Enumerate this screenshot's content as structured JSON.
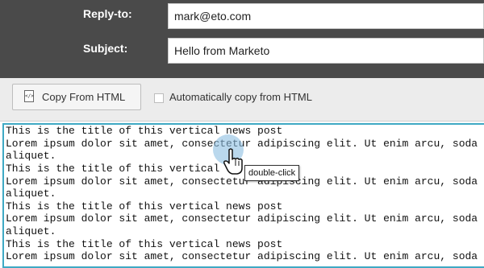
{
  "header": {
    "reply_to_label": "Reply-to:",
    "reply_to_value": "mark@eto.com",
    "subject_label": "Subject:",
    "subject_value": "Hello from Marketo"
  },
  "toolbar": {
    "copy_button_label": "Copy From HTML",
    "auto_copy_label": "Automatically copy from HTML",
    "auto_copy_checked": false
  },
  "editor": {
    "lines": [
      "This is the title of this vertical news post",
      "Lorem ipsum dolor sit amet, consectetur adipiscing elit. Ut enim arcu, soda",
      "aliquet.",
      "This is the title of this vertical",
      "Lorem ipsum dolor sit amet, consectetur adipiscing elit. Ut enim arcu, soda",
      "aliquet.",
      "This is the title of this vertical news post",
      "Lorem ipsum dolor sit amet, consectetur adipiscing elit. Ut enim arcu, soda",
      "aliquet.",
      "This is the title of this vertical news post",
      "Lorem ipsum dolor sit amet, consectetur adipiscing elit. Ut enim arcu, soda"
    ]
  },
  "annotation": {
    "tooltip_text": "double-click",
    "cursor_icon": "hand-pointer-icon"
  },
  "colors": {
    "header_bg": "#4a4a4a",
    "toolbar_bg": "#ececec",
    "editor_border": "#3fa9c4"
  }
}
